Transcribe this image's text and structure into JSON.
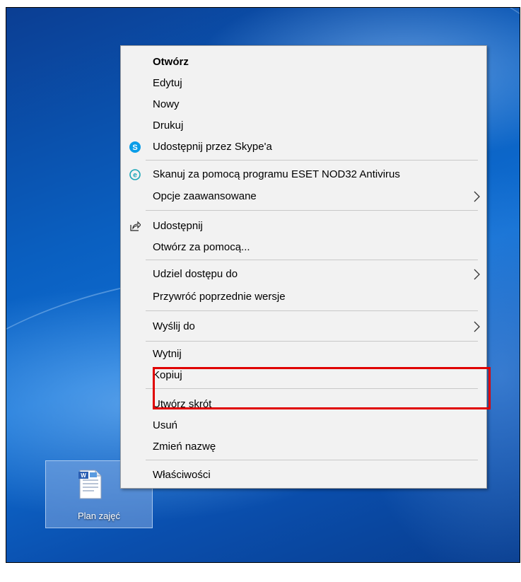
{
  "desktop": {
    "icon_label": "Plan zajęć"
  },
  "menu": {
    "items": [
      {
        "label": "Otwórz"
      },
      {
        "label": "Edytuj"
      },
      {
        "label": "Nowy"
      },
      {
        "label": "Drukuj"
      },
      {
        "label": "Udostępnij przez Skype'a",
        "icon": "skype-icon"
      },
      {
        "label": "Skanuj za pomocą programu ESET NOD32 Antivirus",
        "icon": "eset-icon"
      },
      {
        "label": "Opcje zaawansowane",
        "submenu": true
      },
      {
        "label": "Udostępnij",
        "icon": "share-icon"
      },
      {
        "label": "Otwórz za pomocą..."
      },
      {
        "label": "Udziel dostępu do",
        "submenu": true
      },
      {
        "label": "Przywróć poprzednie wersje"
      },
      {
        "label": "Wyślij do",
        "submenu": true
      },
      {
        "label": "Wytnij"
      },
      {
        "label": "Kopiuj"
      },
      {
        "label": "Utwórz skrót"
      },
      {
        "label": "Usuń"
      },
      {
        "label": "Zmień nazwę"
      },
      {
        "label": "Właściwości"
      }
    ]
  },
  "colors": {
    "highlight": "#e00000",
    "skype": "#0a9de8",
    "eset": "#1aa6b7",
    "menu_bg": "#f2f2f2"
  }
}
